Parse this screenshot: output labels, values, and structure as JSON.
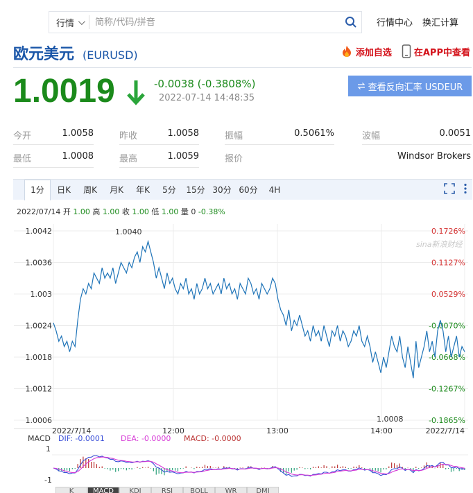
{
  "search": {
    "type_label": "行情",
    "placeholder": "简称/代码/拼音"
  },
  "top_links": [
    "行情中心",
    "换汇计算"
  ],
  "title": {
    "name": "欧元美元",
    "code": "(EURUSD)"
  },
  "title_links": {
    "add_watch": "添加自选",
    "app_view": "在APP中查看"
  },
  "quote": {
    "price": "1.0019",
    "change": "-0.0038 (-0.3808%)",
    "time": "2022-07-14 14:48:35",
    "reverse_button": "查看反向汇率 USDEUR",
    "down_color": "#1b8a1b"
  },
  "stats": {
    "open_label": "今开",
    "open": "1.0058",
    "prev_close_label": "昨收",
    "prev_close": "1.0058",
    "amplitude_label": "振幅",
    "amplitude": "0.5061%",
    "volatility_label": "波幅",
    "volatility": "0.0051",
    "low_label": "最低",
    "low": "1.0008",
    "high_label": "最高",
    "high": "1.0059",
    "quote_by_label": "报价",
    "quote_by": "Windsor Brokers"
  },
  "chart_tabs": [
    "1分",
    "日K",
    "周K",
    "月K",
    "年K",
    "5分",
    "15分",
    "30分",
    "60分",
    "4H"
  ],
  "ohlc": {
    "date": "2022/07/14",
    "open_label": "开",
    "open": "1.00",
    "high_label": "高",
    "high": "1.00",
    "close_label": "收",
    "close": "1.00",
    "low_label": "低",
    "low": "1.00",
    "vol_label": "量",
    "vol": "0",
    "pct": "-0.38%"
  },
  "chart_data": {
    "type": "line",
    "x_ticks": [
      "2022/7/14",
      "12:00",
      "13:00",
      "14:00",
      "2022/7/14"
    ],
    "y_ticks": [
      "1.0042",
      "1.0036",
      "1.003",
      "1.0024",
      "1.0018",
      "1.0012",
      "1.0006"
    ],
    "pct_ticks": [
      "0.1726%",
      "0.1127%",
      "0.0529%",
      "-0.0070%",
      "-0.0668%",
      "-0.1267%",
      "-0.1865%"
    ],
    "max_label": "1.0040",
    "min_label": "1.0008",
    "watermark": "sina新浪财经",
    "ylim": [
      1.0006,
      1.0042
    ],
    "series": [
      {
        "values": [
          1.00245,
          1.0023,
          1.0021,
          1.0022,
          1.002,
          1.0021,
          1.0019,
          1.0021,
          1.002,
          1.0025,
          1.0029,
          1.0031,
          1.003,
          1.0032,
          1.0031,
          1.0034,
          1.0033,
          1.0032,
          1.0035,
          1.0033,
          1.0034,
          1.0033,
          1.0035,
          1.0032,
          1.0034,
          1.0036,
          1.0035,
          1.0034,
          1.0036,
          1.0035,
          1.0037,
          1.0038,
          1.0036,
          1.0039,
          1.0038,
          1.004,
          1.0038,
          1.0036,
          1.0033,
          1.0035,
          1.0033,
          1.0031,
          1.0034,
          1.0032,
          1.0033,
          1.0031,
          1.003,
          1.0032,
          1.0031,
          1.0033,
          1.003,
          1.0031,
          1.0029,
          1.0032,
          1.003,
          1.0031,
          1.0033,
          1.0031,
          1.0032,
          1.003,
          1.0031,
          1.0032,
          1.003,
          1.0033,
          1.0031,
          1.0032,
          1.003,
          1.0031,
          1.0029,
          1.0032,
          1.0031,
          1.003,
          1.0033,
          1.0032,
          1.003,
          1.0031,
          1.0029,
          1.0032,
          1.0031,
          1.003,
          1.0031,
          1.0033,
          1.0032,
          1.0029,
          1.0027,
          1.0026,
          1.0024,
          1.0027,
          1.0023,
          1.0025,
          1.0024,
          1.0026,
          1.0024,
          1.0022,
          1.0023,
          1.0021,
          1.0024,
          1.0022,
          1.0023,
          1.0021,
          1.0024,
          1.0022,
          1.002,
          1.0023,
          1.0022,
          1.0024,
          1.0021,
          1.0023,
          1.0022,
          1.002,
          1.0021,
          1.0023,
          1.0022,
          1.0024,
          1.0021,
          1.002,
          1.0022,
          1.002,
          1.0017,
          1.0019,
          1.0017,
          1.0015,
          1.0018,
          1.0016,
          1.0019,
          1.0022,
          1.002,
          1.0019,
          1.0022,
          1.0018,
          1.0016,
          1.002,
          1.0017,
          1.0014,
          1.0021,
          1.0016,
          1.0018,
          1.002,
          1.0023,
          1.0019,
          1.0021,
          1.0018,
          1.0023,
          1.0025,
          1.0023,
          1.0019,
          1.0022,
          1.0018,
          1.002,
          1.0022,
          1.0018,
          1.002,
          1.0019
        ]
      }
    ]
  },
  "macd": {
    "label": "MACD",
    "dif": "DIF: -0.0001",
    "dea": "DEA: -0.0000",
    "macd": "MACD: -0.0000",
    "y_top": "1",
    "y_bottom": "-1",
    "dif_color": "#3a4fd8",
    "dea_color": "#d63ad6",
    "macd_color": "#b33"
  },
  "bottom_tabs": [
    "K",
    "MACD",
    "KDJ",
    "RSI",
    "BOLL",
    "WR",
    "DMI"
  ]
}
